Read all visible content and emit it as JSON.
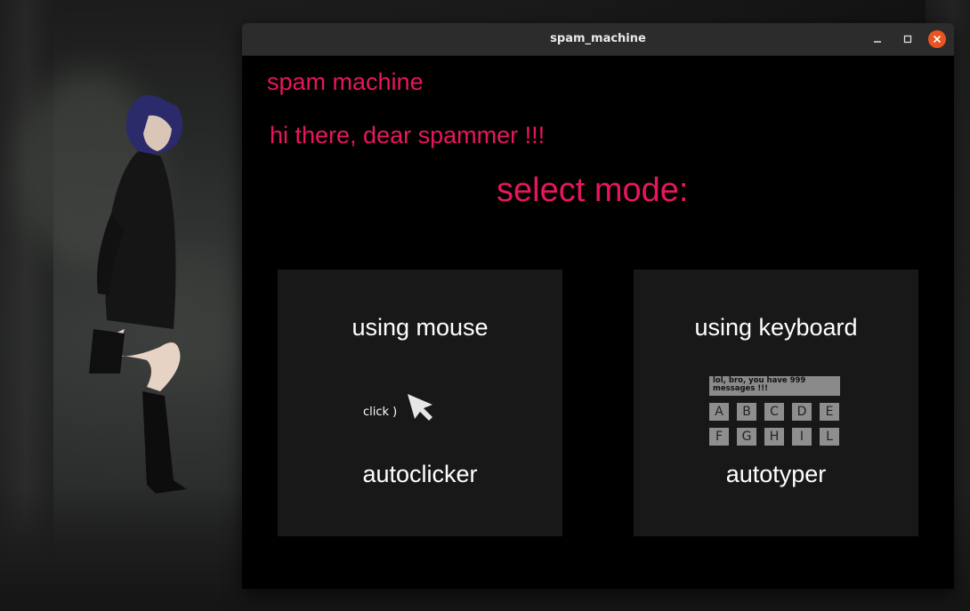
{
  "window": {
    "title": "spam_machine",
    "controls": {
      "minimize": "–",
      "maximize": "☐",
      "close": "✕"
    }
  },
  "app": {
    "title": "spam machine",
    "greeting": "hi there, dear spammer !!!",
    "mode_prompt": "select mode:",
    "accent_color": "#e8175d"
  },
  "modes": [
    {
      "label_top": "using mouse",
      "label_bottom": "autoclicker",
      "illustration_text": "click )",
      "icon": "cursor-arrow-icon"
    },
    {
      "label_top": "using keyboard",
      "label_bottom": "autotyper",
      "illustration_text": "lol, bro, you have 999 messages !!!",
      "keys": [
        "A",
        "B",
        "C",
        "D",
        "E",
        "F",
        "G",
        "H",
        "I",
        "L"
      ],
      "icon": "keyboard-keys-icon"
    }
  ]
}
